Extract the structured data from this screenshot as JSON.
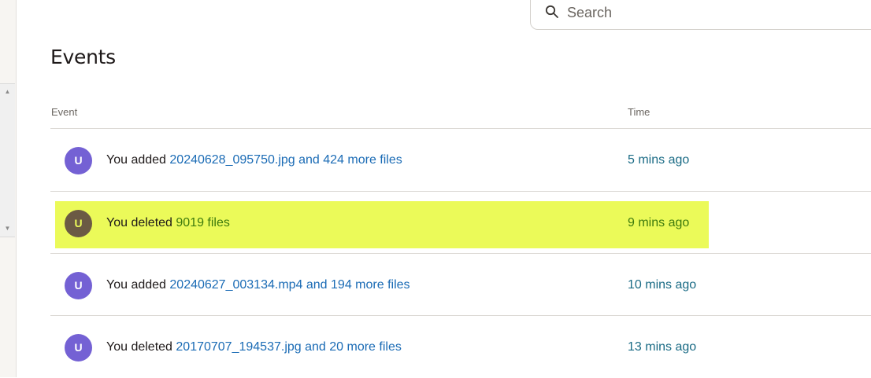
{
  "search": {
    "placeholder": "Search"
  },
  "page": {
    "title": "Events"
  },
  "table": {
    "headers": {
      "event": "Event",
      "time": "Time"
    },
    "rows": [
      {
        "avatar": "U",
        "prefix": "You added ",
        "link": "20240628_095750.jpg and 424 more files",
        "time": "5 mins ago",
        "highlighted": false
      },
      {
        "avatar": "U",
        "prefix": "You deleted ",
        "link": "9019 files",
        "time": "9 mins ago",
        "highlighted": true
      },
      {
        "avatar": "U",
        "prefix": "You added ",
        "link": "20240627_003134.mp4 and 194 more files",
        "time": "10 mins ago",
        "highlighted": false
      },
      {
        "avatar": "U",
        "prefix": "You deleted ",
        "link": "20170707_194537.jpg and 20 more files",
        "time": "13 mins ago",
        "highlighted": false
      }
    ]
  },
  "colors": {
    "avatar": "#7461d4",
    "highlight": "#ebfa59",
    "link": "#1a6bb5"
  }
}
